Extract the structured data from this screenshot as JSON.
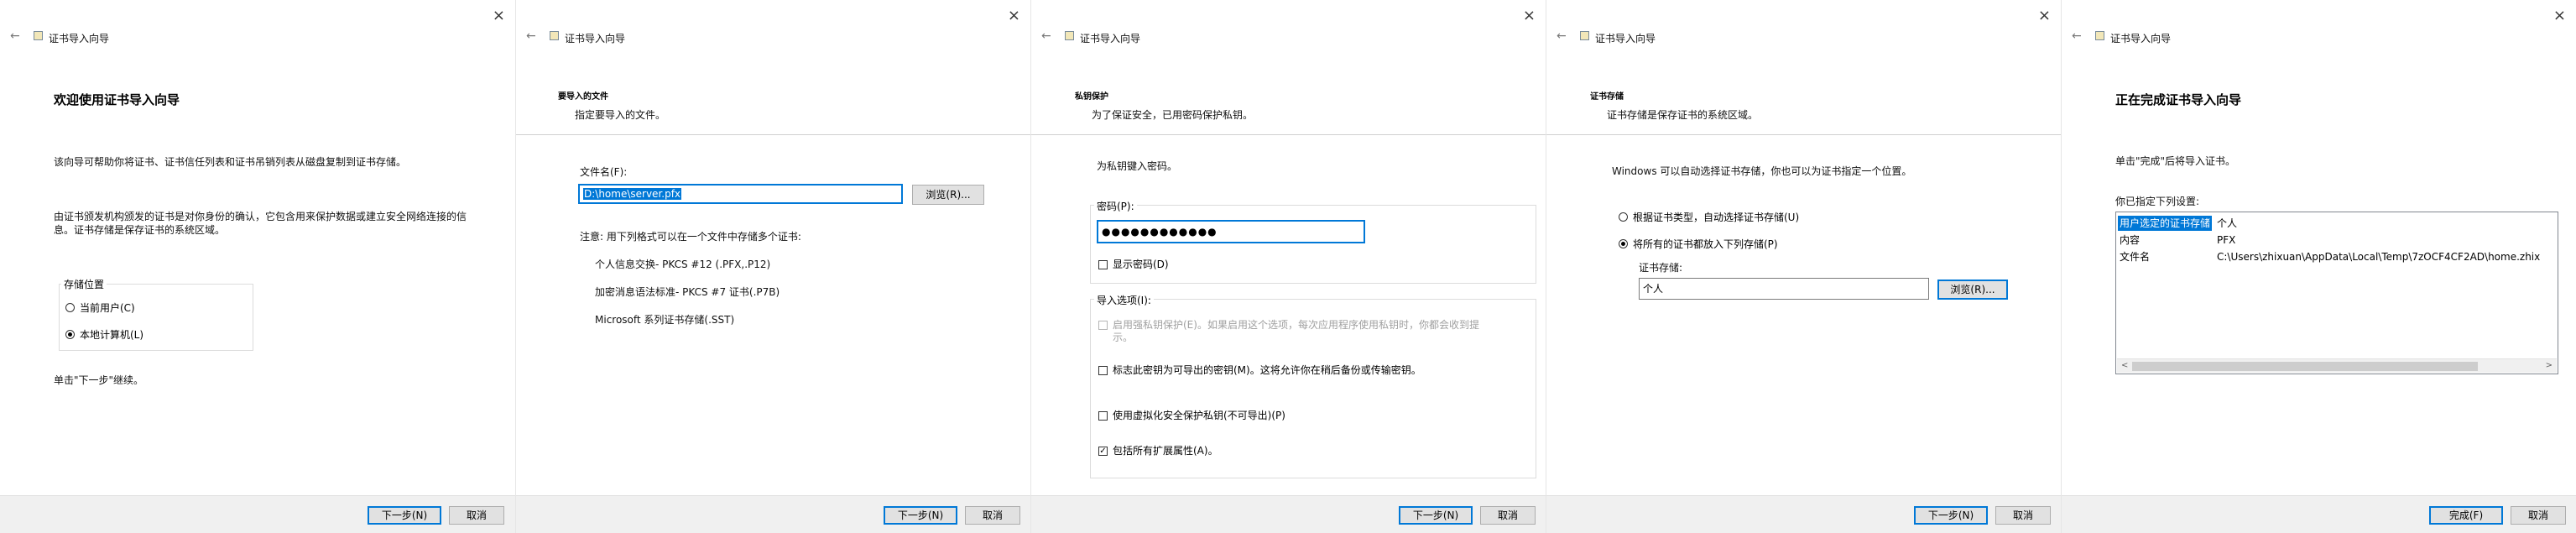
{
  "common": {
    "wizard_title": "证书导入向导",
    "close_icon": "×",
    "back_icon": "←",
    "cancel_label": "取消",
    "next_label": "下一步(N)",
    "finish_label": "完成(F)",
    "browse_label": "浏览(R)..."
  },
  "panel1": {
    "heading": "欢迎使用证书导入向导",
    "para1": "该向导可帮助你将证书、证书信任列表和证书吊销列表从磁盘复制到证书存储。",
    "para2_line1": "由证书颁发机构颁发的证书是对你身份的确认，它包含用来保护数据或建立安全网络连接的信",
    "para2_line2": "息。证书存储是保存证书的系统区域。",
    "store_location_label": "存储位置",
    "radio_current_user": "当前用户(C)",
    "radio_local_machine": "本地计算机(L)",
    "continue_hint": "单击\"下一步\"继续。",
    "next_label": "下一步(N)"
  },
  "panel2": {
    "section_title": "要导入的文件",
    "section_sub": "指定要导入的文件。",
    "filename_label": "文件名(F):",
    "filename_value": "D:\\home\\server.pfx",
    "note": "注意: 用下列格式可以在一个文件中存储多个证书:",
    "formats": [
      "个人信息交换- PKCS #12 (.PFX,.P12)",
      "加密消息语法标准- PKCS #7 证书(.P7B)",
      "Microsoft 系列证书存储(.SST)"
    ]
  },
  "panel3": {
    "section_title": "私钥保护",
    "section_sub": "为了保证安全，已用密码保护私钥。",
    "enter_password_hint": "为私钥键入密码。",
    "password_label": "密码(P):",
    "password_value": "●●●●●●●●●●●●",
    "show_password": "显示密码(D)",
    "import_options_label": "导入选项(I):",
    "opt_strong_line1": "启用强私钥保护(E)。如果启用这个选项，每次应用程序使用私钥时，你都会收到提",
    "opt_strong_line2": "示。",
    "opt_exportable": "标志此密钥为可导出的密钥(M)。这将允许你在稍后备份或传输密钥。",
    "opt_vbs": "使用虚拟化安全保护私钥(不可导出)(P)",
    "opt_extended": "包括所有扩展属性(A)。",
    "checkmark": "✓"
  },
  "panel4": {
    "section_title": "证书存储",
    "section_sub": "证书存储是保存证书的系统区域。",
    "intro": "Windows 可以自动选择证书存储，你也可以为证书指定一个位置。",
    "radio_auto": "根据证书类型，自动选择证书存储(U)",
    "radio_manual": "将所有的证书都放入下列存储(P)",
    "store_label": "证书存储:",
    "store_value": "个人",
    "browse_label": "浏览(R)..."
  },
  "panel5": {
    "heading": "正在完成证书导入向导",
    "click_finish": "单击\"完成\"后将导入证书。",
    "settings_label": "你已指定下列设置:",
    "rows": [
      {
        "key": "用户选定的证书存储",
        "value": "个人"
      },
      {
        "key": "内容",
        "value": "PFX"
      },
      {
        "key": "文件名",
        "value": "C:\\Users\\zhixuan\\AppData\\Local\\Temp\\7zOCF4CF2AD\\home.zhix"
      }
    ],
    "scroll_left": "<",
    "scroll_right": ">"
  }
}
